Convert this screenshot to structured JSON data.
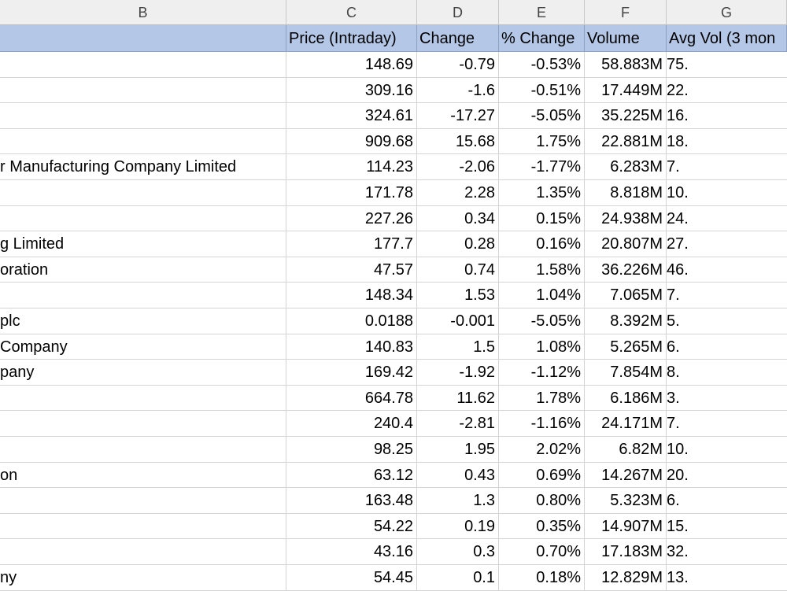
{
  "column_letters": [
    "B",
    "C",
    "D",
    "E",
    "F",
    "G"
  ],
  "headers": {
    "b": "",
    "c": "Price (Intraday)",
    "d": "Change",
    "e": "% Change",
    "f": "Volume",
    "g": "Avg Vol (3 mon"
  },
  "rows": [
    {
      "name": "",
      "price": "148.69",
      "change": "-0.79",
      "pct": "-0.53%",
      "volume": "58.883M",
      "avg": "75."
    },
    {
      "name": "",
      "price": "309.16",
      "change": "-1.6",
      "pct": "-0.51%",
      "volume": "17.449M",
      "avg": "22."
    },
    {
      "name": "",
      "price": "324.61",
      "change": "-17.27",
      "pct": "-5.05%",
      "volume": "35.225M",
      "avg": "16."
    },
    {
      "name": "",
      "price": "909.68",
      "change": "15.68",
      "pct": "1.75%",
      "volume": "22.881M",
      "avg": "18."
    },
    {
      "name": "r Manufacturing Company Limited",
      "price": "114.23",
      "change": "-2.06",
      "pct": "-1.77%",
      "volume": "6.283M",
      "avg": "7."
    },
    {
      "name": "",
      "price": "171.78",
      "change": "2.28",
      "pct": "1.35%",
      "volume": "8.818M",
      "avg": "10."
    },
    {
      "name": "",
      "price": "227.26",
      "change": "0.34",
      "pct": "0.15%",
      "volume": "24.938M",
      "avg": "24."
    },
    {
      "name": "g Limited",
      "price": "177.7",
      "change": "0.28",
      "pct": "0.16%",
      "volume": "20.807M",
      "avg": "27."
    },
    {
      "name": "oration",
      "price": "47.57",
      "change": "0.74",
      "pct": "1.58%",
      "volume": "36.226M",
      "avg": "46."
    },
    {
      "name": "",
      "price": "148.34",
      "change": "1.53",
      "pct": "1.04%",
      "volume": "7.065M",
      "avg": "7."
    },
    {
      "name": "plc",
      "price": "0.0188",
      "change": "-0.001",
      "pct": "-5.05%",
      "volume": "8.392M",
      "avg": "5."
    },
    {
      "name": " Company",
      "price": "140.83",
      "change": "1.5",
      "pct": "1.08%",
      "volume": "5.265M",
      "avg": "6."
    },
    {
      "name": "pany",
      "price": "169.42",
      "change": "-1.92",
      "pct": "-1.12%",
      "volume": "7.854M",
      "avg": "8."
    },
    {
      "name": "",
      "price": "664.78",
      "change": "11.62",
      "pct": "1.78%",
      "volume": "6.186M",
      "avg": "3."
    },
    {
      "name": "",
      "price": "240.4",
      "change": "-2.81",
      "pct": "-1.16%",
      "volume": "24.171M",
      "avg": "7."
    },
    {
      "name": "",
      "price": "98.25",
      "change": "1.95",
      "pct": "2.02%",
      "volume": "6.82M",
      "avg": "10."
    },
    {
      "name": "on",
      "price": "63.12",
      "change": "0.43",
      "pct": "0.69%",
      "volume": "14.267M",
      "avg": "20."
    },
    {
      "name": "",
      "price": "163.48",
      "change": "1.3",
      "pct": "0.80%",
      "volume": "5.323M",
      "avg": "6."
    },
    {
      "name": "",
      "price": "54.22",
      "change": "0.19",
      "pct": "0.35%",
      "volume": "14.907M",
      "avg": "15."
    },
    {
      "name": "",
      "price": "43.16",
      "change": "0.3",
      "pct": "0.70%",
      "volume": "17.183M",
      "avg": "32."
    },
    {
      "name": "ny",
      "price": "54.45",
      "change": "0.1",
      "pct": "0.18%",
      "volume": "12.829M",
      "avg": "13."
    }
  ],
  "colors": {
    "header_fill": "#b4c7e7",
    "column_header_fill": "#efefef",
    "gridline": "#d4d4d4"
  }
}
